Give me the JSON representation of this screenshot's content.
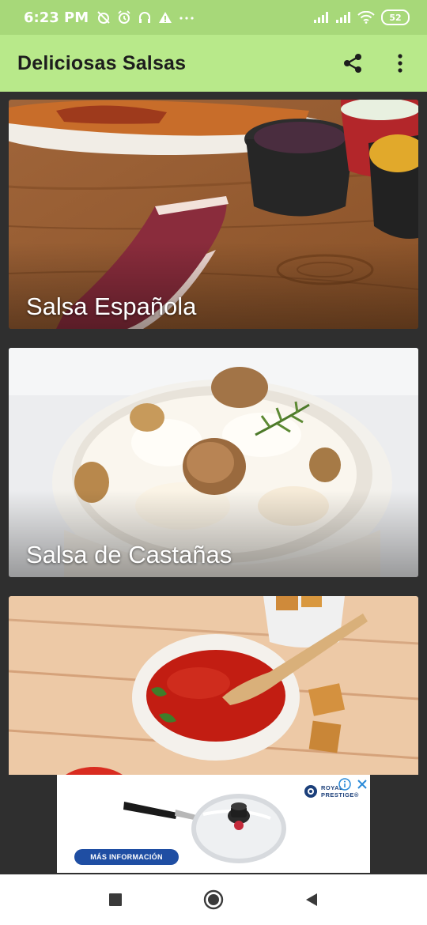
{
  "status_bar": {
    "time": "6:23 PM",
    "battery": "52",
    "icons": [
      "alarm-off-icon",
      "alarm-icon",
      "headset-icon",
      "warning-icon",
      "more-dots-icon",
      "signal-icon",
      "signal-icon",
      "wifi-icon",
      "battery-icon"
    ]
  },
  "app_bar": {
    "title": "Deliciosas Salsas",
    "background": "#b8e98a",
    "actions": [
      "share-icon",
      "overflow-menu-icon"
    ]
  },
  "recipes": [
    {
      "title": "Salsa Española"
    },
    {
      "title": "Salsa de Castañas"
    },
    {
      "title": ""
    }
  ],
  "ad": {
    "cta_label": "MÁS INFORMACIÓN",
    "brand_line1": "ROYAL",
    "brand_line2": "PRESTIGE®",
    "icons": [
      "ad-info-icon",
      "ad-close-icon"
    ]
  },
  "nav_bar": {
    "buttons": [
      "recents-square-icon",
      "home-circle-icon",
      "back-triangle-icon"
    ]
  },
  "colors": {
    "status_bar": "#a7d879",
    "app_bar": "#b8e98a",
    "list_background": "#2f2f2f",
    "ad_button": "#1f4ea3"
  }
}
